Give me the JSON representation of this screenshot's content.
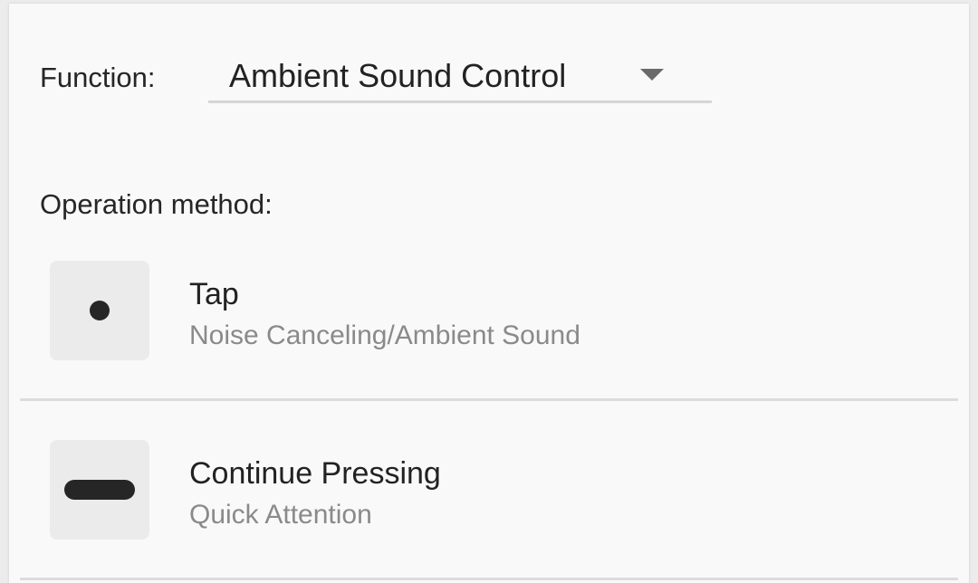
{
  "function_row": {
    "label": "Function:",
    "selected_value": "Ambient Sound Control",
    "dropdown_icon": "triangle-down-icon"
  },
  "operation": {
    "label": "Operation method:",
    "items": [
      {
        "title": "Tap",
        "subtitle": "Noise Canceling/Ambient Sound",
        "icon": "dot-icon"
      },
      {
        "title": "Continue Pressing",
        "subtitle": "Quick Attention",
        "icon": "long-bar-icon"
      }
    ]
  },
  "colors": {
    "background": "#f9f9f9",
    "primary_text": "#222222",
    "secondary_text": "#8a8a8a",
    "icon_fill": "#262626",
    "icon_box": "#ebebeb",
    "divider": "#dcdcdc"
  }
}
